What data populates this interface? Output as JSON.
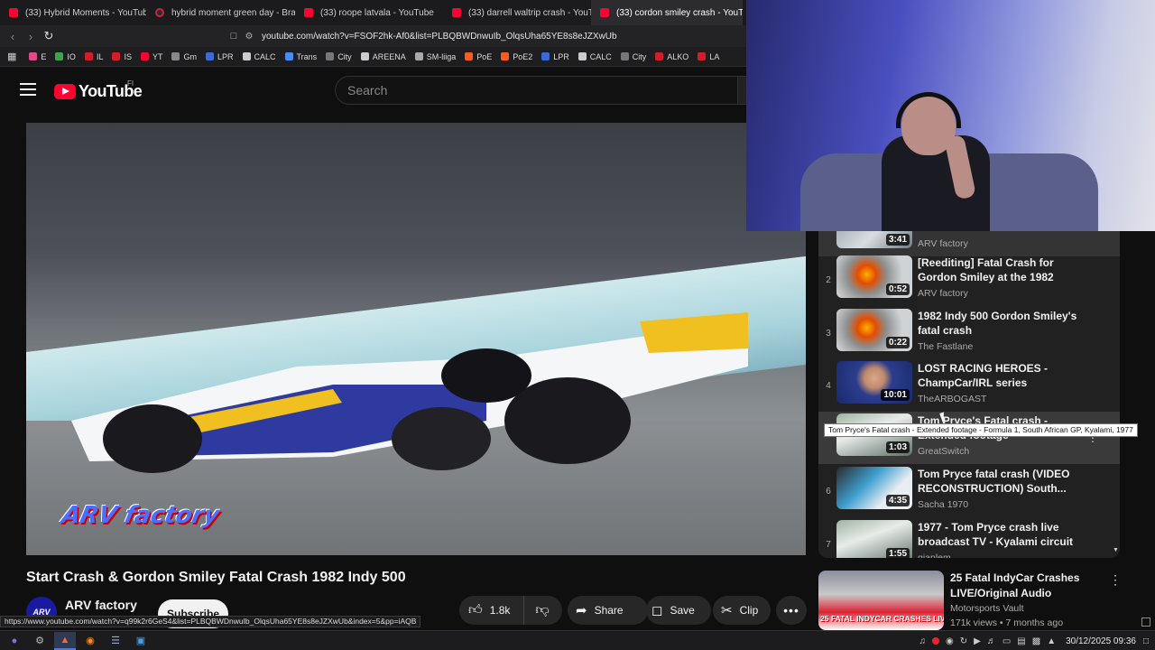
{
  "browser": {
    "tabs": [
      {
        "label": "(33) Hybrid Moments - YouTube",
        "icon": "youtube-icon",
        "active": false
      },
      {
        "label": "hybrid moment green day - Bra",
        "icon": "brave-icon",
        "active": false
      },
      {
        "label": "(33) roope latvala - YouTube",
        "icon": "youtube-icon",
        "active": false
      },
      {
        "label": "(33) darrell waltrip crash - YouTu",
        "icon": "youtube-icon",
        "active": false
      },
      {
        "label": "(33) cordon smiley crash - YouTu",
        "icon": "youtube-icon",
        "active": true
      }
    ],
    "url": "youtube.com/watch?v=FSOF2hk-Af0&list=PLBQBWDnwuIb_OlqsUha65YE8s8eJZXwUb",
    "bookmarks": [
      {
        "label": "E",
        "color": "#e04a8a"
      },
      {
        "label": "IO",
        "color": "#3aa54a"
      },
      {
        "label": "IL",
        "color": "#d21e2b"
      },
      {
        "label": "IS",
        "color": "#d21e2b"
      },
      {
        "label": "YT",
        "color": "#ff0033"
      },
      {
        "label": "Gm",
        "color": "#888888"
      },
      {
        "label": "LPR",
        "color": "#3b6ad6"
      },
      {
        "label": "CALC",
        "color": "#cccccc"
      },
      {
        "label": "Trans",
        "color": "#4a8af4"
      },
      {
        "label": "City",
        "color": "#777777"
      },
      {
        "label": "AREENA",
        "color": "#cccccc"
      },
      {
        "label": "SM-liiga",
        "color": "#aaaaaa"
      },
      {
        "label": "PoE",
        "color": "#ff5a1f"
      },
      {
        "label": "PoE2",
        "color": "#ff5a1f"
      },
      {
        "label": "LPR",
        "color": "#3b6ad6"
      },
      {
        "label": "CALC",
        "color": "#cccccc"
      },
      {
        "label": "City",
        "color": "#777777"
      },
      {
        "label": "ALKO",
        "color": "#d21e2b"
      },
      {
        "label": "LA",
        "color": "#d21e2b"
      }
    ],
    "status_url": "https://www.youtube.com/watch?v=q99k2r6GeS4&list=PLBQBWDnwuIb_OlqsUha65YE8s8eJZXwUb&index=5&pp=iAQB"
  },
  "youtube": {
    "logo_text": "YouTube",
    "country_code": "FI",
    "search_placeholder": "Search",
    "video_watermark": "ARV factory",
    "video_title": "Start Crash & Gordon Smiley Fatal Crash 1982 Indy 500",
    "channel_name": "ARV factory",
    "channel_avatar_text": "ARV",
    "subscribe_label": "Subscribe",
    "likes": "1.8k",
    "share_label": "Share",
    "save_label": "Save",
    "clip_label": "Clip"
  },
  "playlist": [
    {
      "index": "",
      "duration": "3:41",
      "title": "",
      "channel": "ARV factory",
      "thumb": "car"
    },
    {
      "index": "2",
      "duration": "0:52",
      "title": "[Reediting] Fatal Crash for Gordon Smiley at the 1982 Ind...",
      "channel": "ARV factory",
      "thumb": "fire"
    },
    {
      "index": "3",
      "duration": "0:22",
      "title": "1982 Indy 500 Gordon Smiley's fatal crash",
      "channel": "The Fastlane",
      "thumb": "fire"
    },
    {
      "index": "4",
      "duration": "10:01",
      "title": "LOST RACING HEROES - ChampCar/IRL series",
      "channel": "TheARBOGAST",
      "thumb": "face"
    },
    {
      "index": "",
      "duration": "1:03",
      "title": "Tom Pryce's Fatal crash - Extended footage",
      "channel": "GreatSwitch",
      "thumb": "f1"
    },
    {
      "index": "6",
      "duration": "4:35",
      "title": "Tom Pryce fatal crash (VIDEO RECONSTRUCTION) South...",
      "channel": "Sacha 1970",
      "thumb": "recon"
    },
    {
      "index": "7",
      "duration": "1:55",
      "title": "1977 - Tom Pryce crash live broadcast TV - Kyalami circuit",
      "channel": "gianlem",
      "thumb": "f1"
    }
  ],
  "tooltip": "Tom Pryce's Fatal crash - Extended footage - Formula 1, South African GP, Kyalami, 1977",
  "recommended": {
    "title": "25 Fatal IndyCar Crashes LIVE/Original Audio",
    "channel": "Motorsports Vault",
    "meta": "171k views • 7 months ago",
    "thumb_text": "25 FATAL INDYCAR CRASHES LIVE"
  },
  "taskbar": {
    "clock": "30/12/2025 09:36"
  },
  "colors": {
    "accent_red": "#ff0033",
    "background": "#0f0f0f"
  }
}
